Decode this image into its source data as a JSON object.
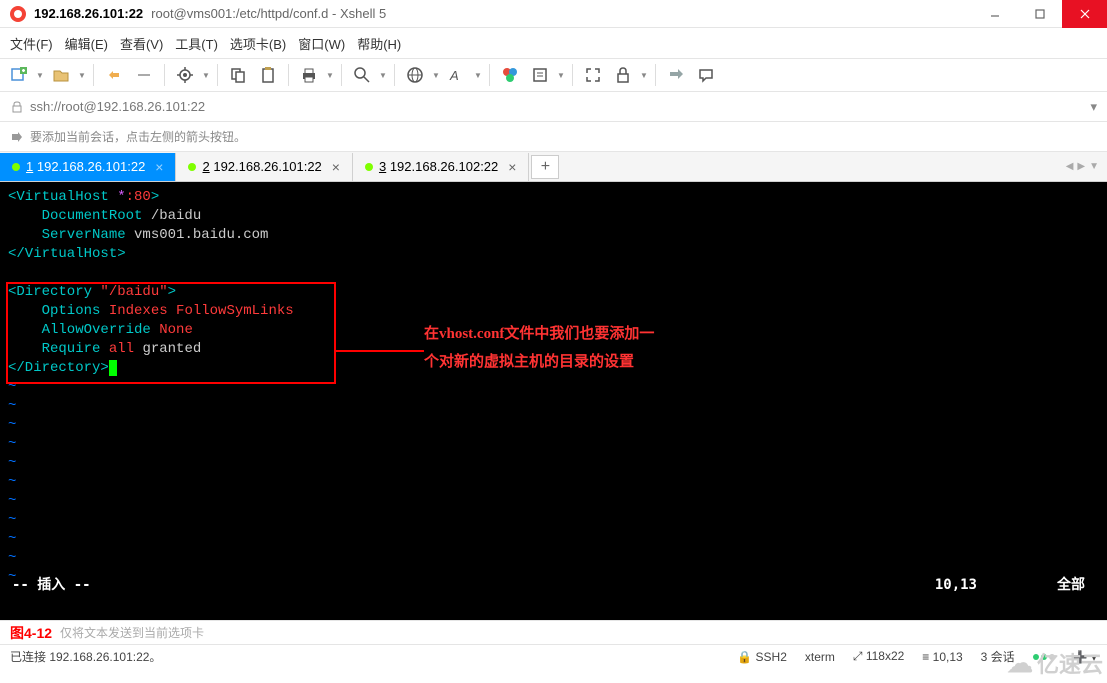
{
  "title": {
    "host": "192.168.26.101:22",
    "path": "root@vms001:/etc/httpd/conf.d - Xshell 5"
  },
  "menu": {
    "file": "文件(F)",
    "edit": "编辑(E)",
    "view": "查看(V)",
    "tools": "工具(T)",
    "tabs": "选项卡(B)",
    "window": "窗口(W)",
    "help": "帮助(H)"
  },
  "address": "ssh://root@192.168.26.101:22",
  "hint": "要添加当前会话，点击左侧的箭头按钮。",
  "tabs": [
    {
      "num": "1",
      "label": "192.168.26.101:22",
      "active": true
    },
    {
      "num": "2",
      "label": "192.168.26.101:22",
      "active": false
    },
    {
      "num": "3",
      "label": "192.168.26.102:22",
      "active": false
    }
  ],
  "code": {
    "l1_open": "<VirtualHost ",
    "l1_star": "*",
    "l1_port": ":80",
    "l1_close": ">",
    "l2_kw": "    DocumentRoot ",
    "l2_val": "/baidu",
    "l3_kw": "    ServerName ",
    "l3_val": "vms001.baidu.com",
    "l4": "</VirtualHost>",
    "l6_open": "<Directory ",
    "l6_path": "\"/baidu\"",
    "l6_close": ">",
    "l7_kw": "    Options ",
    "l7_val": "Indexes FollowSymLinks",
    "l8_kw": "    AllowOverride ",
    "l8_val": "None",
    "l9_kw": "    Require ",
    "l9_all": "all",
    "l9_grant": " granted",
    "l10": "</Directory>",
    "tilde": "~"
  },
  "annotation": {
    "line1": "在vhost.conf文件中我们也要添加一",
    "line2": "个对新的虚拟主机的目录的设置"
  },
  "term_status": {
    "mode": "-- 插入 --",
    "pos": "10,13",
    "all": "全部"
  },
  "footer1": {
    "fig": "图4-12",
    "text": "仅将文本发送到当前选项卡"
  },
  "footer2": {
    "conn": "已连接 192.168.26.101:22。",
    "ssh": "SSH2",
    "term": "xterm",
    "size": "118x22",
    "pos": "10,13",
    "sess": "3 会话"
  },
  "watermark": "亿速云"
}
